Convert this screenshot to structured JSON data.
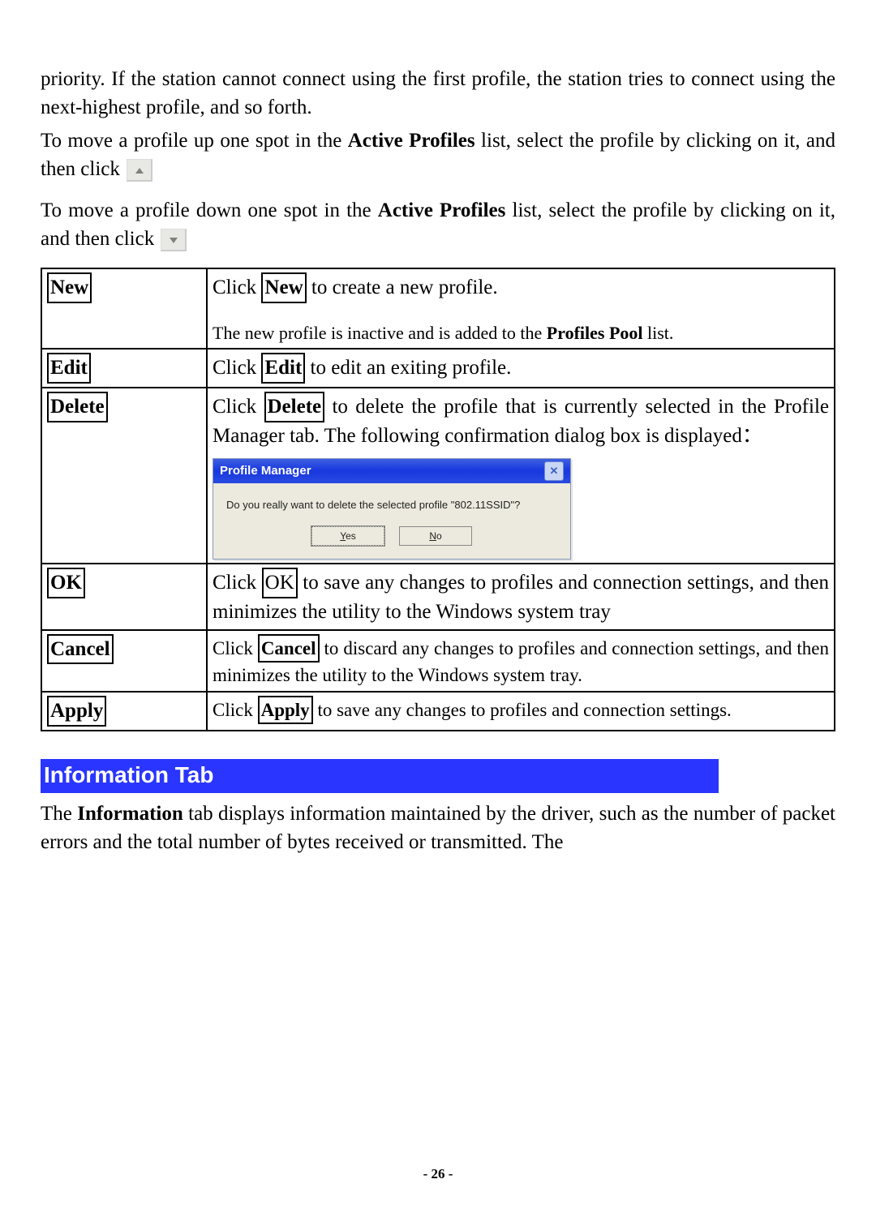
{
  "intro": {
    "p1": "priority. If the station cannot connect using the first profile, the station tries to connect using the next-highest profile, and so forth.",
    "p2_pre": "To move a profile up one spot in the ",
    "p2_bold": "Active Profiles",
    "p2_post": " list, select the profile by clicking on it, and then click ",
    "p3_pre": "To move a profile down one spot in the ",
    "p3_bold": "Active Profiles",
    "p3_post": " list, select the profile by clicking on it, and then click "
  },
  "table": {
    "rows": [
      {
        "label": "New",
        "desc_click": "Click ",
        "desc_btn": "New",
        "desc_after": " to create a new profile.",
        "note_pre": "The new profile is inactive and is added to the ",
        "note_bold": "Profiles Pool",
        "note_post": " list."
      },
      {
        "label": "Edit",
        "desc_click": "Click ",
        "desc_btn": "Edit",
        "desc_after": " to edit an exiting profile."
      },
      {
        "label": "Delete",
        "desc_click": "Click ",
        "desc_btn": "Delete",
        "desc_after": " to delete the profile that is currently selected in the Profile Manager tab. The following confirmation dialog box is displayed："
      },
      {
        "label": "OK",
        "desc_click": "Click ",
        "desc_btn": "OK",
        "desc_after": " to save any changes to profiles and connection settings, and then minimizes the utility to the Windows system tray"
      },
      {
        "label": "Cancel",
        "desc_click": "Click ",
        "desc_btn": "Cancel",
        "desc_after": " to discard any changes to profiles and connection settings, and then minimizes the utility to the Windows system tray."
      },
      {
        "label": "Apply",
        "desc_click": "Click ",
        "desc_btn": "Apply",
        "desc_after": " to save any changes to profiles and connection settings."
      }
    ]
  },
  "dialog": {
    "title": "Profile Manager",
    "message": "Do you really want to delete the selected profile \"802.11SSID\"?",
    "yes": "Yes",
    "no": "No"
  },
  "section": {
    "title": "Information Tab",
    "body_pre": "The ",
    "body_bold": "Information",
    "body_post": " tab displays information maintained by the driver, such as the number of packet errors and the total number of bytes received or transmitted. The"
  },
  "page_number": "- 26 -"
}
